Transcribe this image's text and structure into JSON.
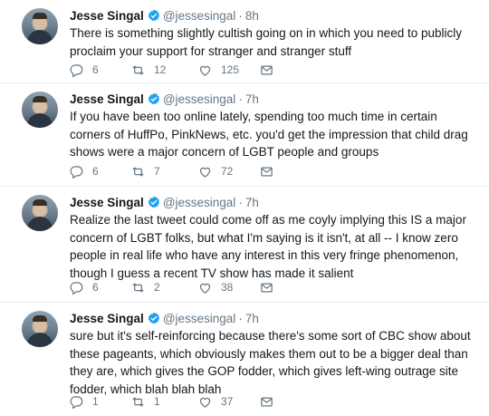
{
  "tweets": [
    {
      "name": "Jesse Singal",
      "handle": "@jessesingal",
      "dot": "·",
      "time": "8h",
      "text": "There is something slightly cultish going on in which you need to publicly proclaim your support for stranger and stranger stuff",
      "replies": "6",
      "retweets": "12",
      "likes": "125"
    },
    {
      "name": "Jesse Singal",
      "handle": "@jessesingal",
      "dot": "·",
      "time": "7h",
      "text": "If you have been too online lately, spending too much time in certain corners of HuffPo, PinkNews, etc. you'd get the impression that child drag shows were a major concern of LGBT people and groups",
      "replies": "6",
      "retweets": "7",
      "likes": "72"
    },
    {
      "name": "Jesse Singal",
      "handle": "@jessesingal",
      "dot": "·",
      "time": "7h",
      "text": "Realize the last tweet could come off as me coyly implying this IS a major concern of LGBT folks, but what I'm saying is it isn't, at all -- I know zero people in real life who have any interest in this very fringe phenomenon, though I guess a recent TV show has made it salient",
      "replies": "6",
      "retweets": "2",
      "likes": "38"
    },
    {
      "name": "Jesse Singal",
      "handle": "@jessesingal",
      "dot": "·",
      "time": "7h",
      "text": "sure but it's self-reinforcing because there's some sort of CBC show about these pageants, which obviously makes them out to be a bigger deal than they are, which gives the GOP fodder, which gives left-wing outrage site fodder, which blah blah blah",
      "replies": "1",
      "retweets": "1",
      "likes": "37"
    }
  ],
  "icons": {
    "reply": "reply-icon",
    "retweet": "retweet-icon",
    "like": "heart-icon",
    "dm": "envelope-icon",
    "verified": "verified-badge-icon"
  },
  "colors": {
    "icon_gray": "#657786",
    "verified_blue": "#1da1f2",
    "divider": "#e6ecf0"
  }
}
